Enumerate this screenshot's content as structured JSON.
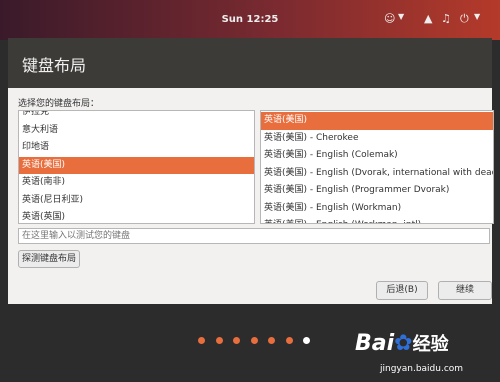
{
  "topbar": {
    "clock": "Sun 12:25"
  },
  "window": {
    "title": "键盘布局",
    "prompt": "选择您的键盘布局：",
    "layouts": [
      "伊拉克",
      "意大利语",
      "印地语",
      "英语(美国)",
      "英语(南非)",
      "英语(尼日利亚)",
      "英语(英国)"
    ],
    "layouts_selected_index": 3,
    "variants": [
      "英语(美国)",
      "英语(美国) - Cherokee",
      "英语(美国) - English (Colemak)",
      "英语(美国) - English (Dvorak, international with dead keys)",
      "英语(美国) - English (Programmer Dvorak)",
      "英语(美国) - English (Workman)",
      "英语(美国) - English (Workman, intl)"
    ],
    "variants_selected_index": 0,
    "test_placeholder": "在这里输入以测试您的键盘",
    "detect_label": "探测键盘布局",
    "back_label": "后退(B)",
    "continue_label": "继续"
  },
  "progress": {
    "steps": 7,
    "current": 7
  },
  "watermark": {
    "brand": "Bai",
    "suffix": "经验",
    "url": "jingyan.baidu.com"
  },
  "colors": {
    "accent": "#e86e3e"
  }
}
